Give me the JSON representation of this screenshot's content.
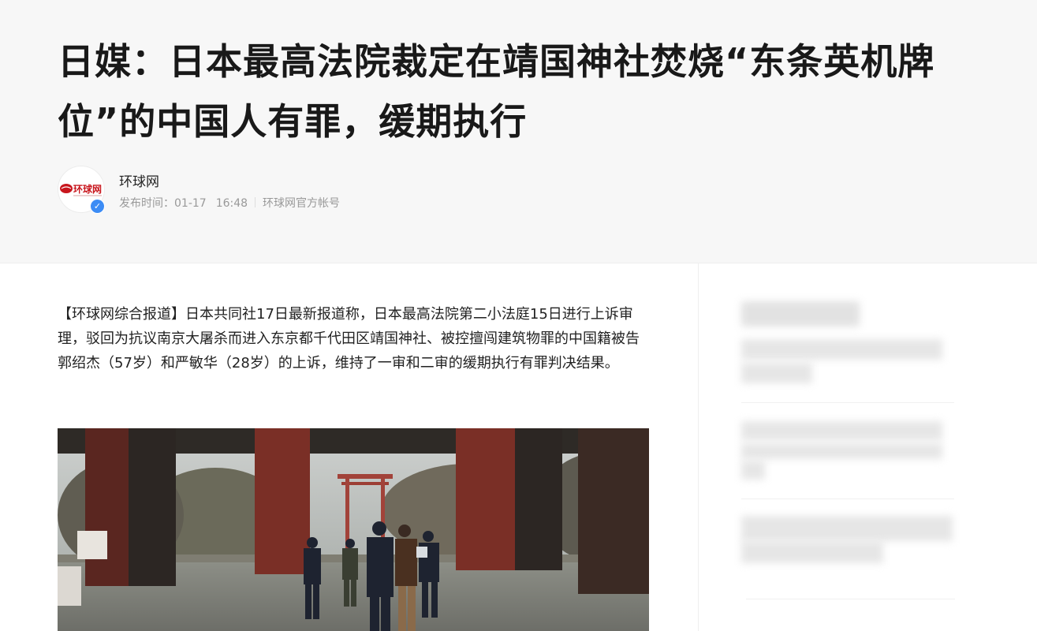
{
  "article": {
    "title": "日媒：日本最高法院裁定在靖国神社焚烧“东条英机牌位”的中国人有罪，缓期执行",
    "author": {
      "name": "环球网",
      "avatar_text": "环球网",
      "verified_icon": "verified-badge-icon"
    },
    "meta": {
      "published_label": "发布时间：",
      "date": "01-17",
      "time": "16:48",
      "account": "环球网官方帐号"
    },
    "lead": "【环球网综合报道】日本共同社17日最新报道称，日本最高法院第二小法庭15日进行上诉审理，驳回为抗议南京大屠杀而进入东京都千代田区靖国神社、被控擅闯建筑物罪的中国籍被告郭绍杰（57岁）和严敏华（28岁）的上诉，维持了一审和二审的缓期执行有罪判决结果。"
  },
  "colors": {
    "header_bg": "#f7f7f7",
    "title": "#191919",
    "meta": "#999999",
    "verified": "#3c8cf5",
    "logo_red": "#c8161d"
  }
}
